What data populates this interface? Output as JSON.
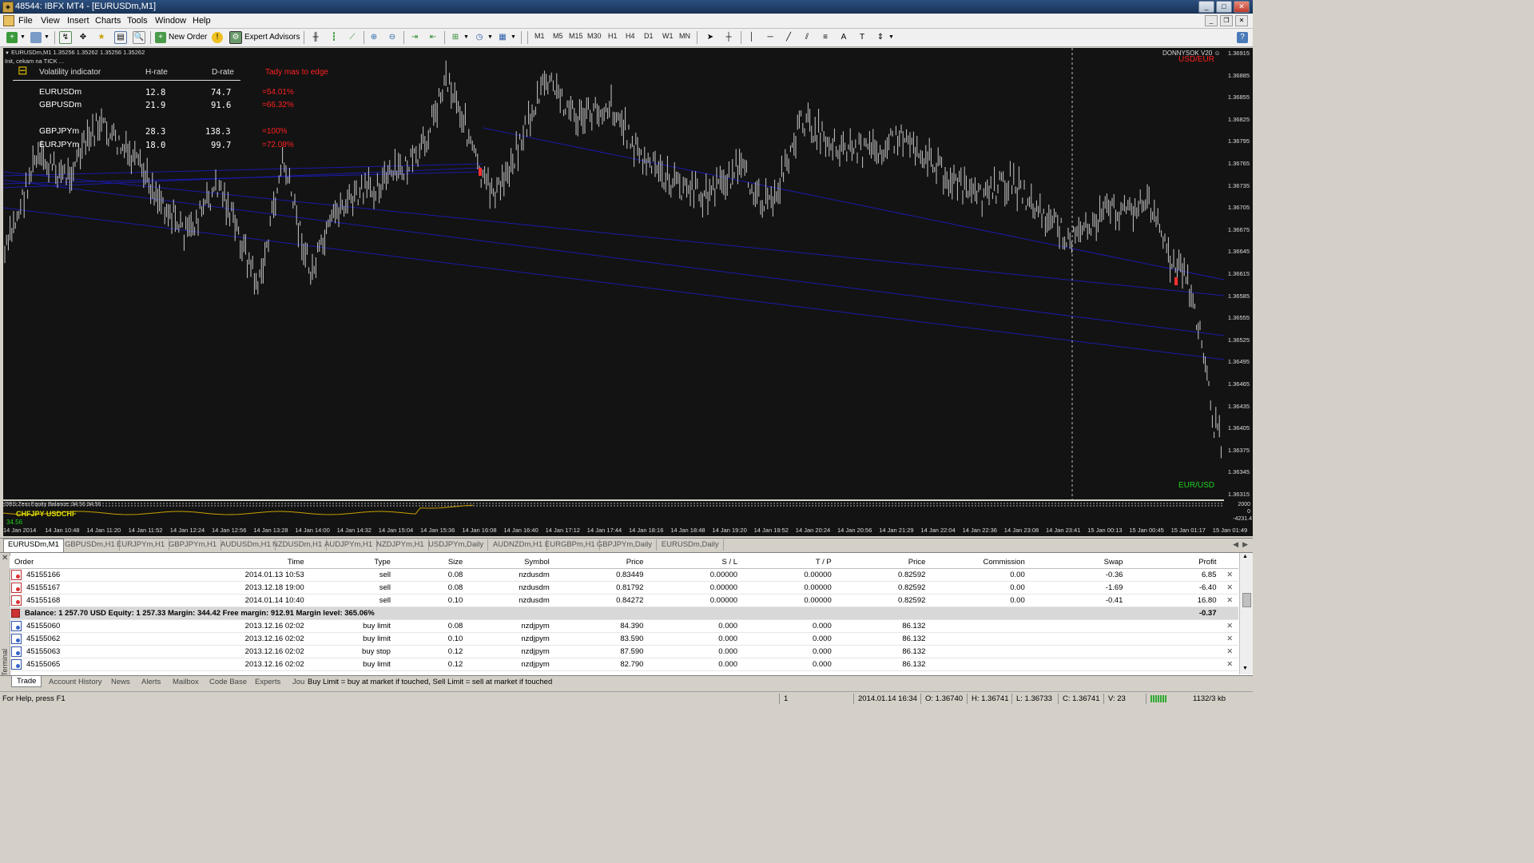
{
  "window": {
    "title": "48544: IBFX MT4 - [EURUSDm,M1]"
  },
  "menu": [
    "File",
    "View",
    "Insert",
    "Charts",
    "Tools",
    "Window",
    "Help"
  ],
  "toolbar": {
    "new_order": "New Order",
    "expert_advisors": "Expert Advisors",
    "timeframes": [
      "M1",
      "M5",
      "M15",
      "M30",
      "H1",
      "H4",
      "D1",
      "W1",
      "MN"
    ]
  },
  "chart": {
    "header": "EURUSDm,M1  1.35256 1.35262 1.35256 1.35262",
    "init_text": "Init, cekam na TICK ...",
    "donnysok": "DONNYSOK V20",
    "usd_eur": "USD/EUR",
    "eur_usd": "EUR/USD",
    "colors": {
      "bg": "#131313",
      "candle": "#c8c8c8",
      "trendline": "#1a1aa8",
      "red_label": "#ff2020",
      "green_label": "#20d020"
    },
    "indicator_table": {
      "title": "Volatility indicator",
      "col_h": "H-rate",
      "col_d": "D-rate",
      "edge_label": "Tady mas to edge",
      "rows": [
        {
          "sym": "EURUSDm",
          "h": "12.8",
          "d": "74.7",
          "edge": "=54.01%"
        },
        {
          "sym": "GBPUSDm",
          "h": "21.9",
          "d": "91.6",
          "edge": "=66.32%"
        },
        {
          "sym": "GBPJPYm",
          "h": "28.3",
          "d": "138.3",
          "edge": "=100%"
        },
        {
          "sym": "EURJPYm",
          "h": "18.0",
          "d": "99.7",
          "edge": "=72.08%"
        }
      ]
    },
    "subwindow": {
      "label": "DBS Zero Equity Balance: 34.56 34.56",
      "pair_label": "CHFJPY  USDCHF",
      "value_label": "34.56",
      "scale": [
        "2000",
        "0",
        "-4231.4"
      ]
    },
    "price_labels": [
      "1.36915",
      "1.36885",
      "1.36855",
      "1.36825",
      "1.36795",
      "1.36765",
      "1.36735",
      "1.36705",
      "1.36675",
      "1.36645",
      "1.36615",
      "1.36585",
      "1.36555",
      "1.36525",
      "1.36495",
      "1.36465",
      "1.36435",
      "1.36405",
      "1.36375",
      "1.36345",
      "1.36315"
    ],
    "time_labels": [
      "14 Jan 2014",
      "14 Jan 10:48",
      "14 Jan 11:20",
      "14 Jan 11:52",
      "14 Jan 12:24",
      "14 Jan 12:56",
      "14 Jan 13:28",
      "14 Jan 14:00",
      "14 Jan 14:32",
      "14 Jan 15:04",
      "14 Jan 15:36",
      "14 Jan 16:08",
      "14 Jan 16:40",
      "14 Jan 17:12",
      "14 Jan 17:44",
      "14 Jan 18:16",
      "14 Jan 18:48",
      "14 Jan 19:20",
      "14 Jan 19:52",
      "14 Jan 20:24",
      "14 Jan 20:56",
      "14 Jan 21:29",
      "14 Jan 22:04",
      "14 Jan 22:36",
      "14 Jan 23:08",
      "14 Jan 23:41",
      "15 Jan 00:13",
      "15 Jan 00:45",
      "15 Jan 01:17",
      "15 Jan 01:49"
    ]
  },
  "chart_tabs": [
    "EURUSDm,M1",
    "GBPUSDm,H1",
    "EURJPYm,H1",
    "GBPJPYm,H1",
    "AUDUSDm,H1",
    "NZDUSDm,H1",
    "AUDJPYm,H1",
    "NZDJPYm,H1",
    "USDJPYm,Daily",
    "AUDNZDm,H1",
    "EURGBPm,H1",
    "GBPJPYm,Daily",
    "EURUSDm,Daily"
  ],
  "trade": {
    "headers": [
      "Order",
      "Time",
      "Type",
      "Size",
      "Symbol",
      "Price",
      "S / L",
      "T / P",
      "Price",
      "Commission",
      "Swap",
      "Profit"
    ],
    "rows_sell": [
      [
        "45155166",
        "2014.01.13 10:53",
        "sell",
        "0.08",
        "nzdusdm",
        "0.83449",
        "0.00000",
        "0.00000",
        "0.82592",
        "0.00",
        "-0.36",
        "6.85"
      ],
      [
        "45155167",
        "2013.12.18 19:00",
        "sell",
        "0.08",
        "nzdusdm",
        "0.81792",
        "0.00000",
        "0.00000",
        "0.82592",
        "0.00",
        "-1.69",
        "-6.40"
      ],
      [
        "45155168",
        "2014.01.14 10:40",
        "sell",
        "0.10",
        "nzdusdm",
        "0.84272",
        "0.00000",
        "0.00000",
        "0.82592",
        "0.00",
        "-0.41",
        "16.80"
      ]
    ],
    "summary": "Balance: 1 257.70 USD  Equity: 1 257.33  Margin: 344.42  Free margin: 912.91  Margin level: 365.06%",
    "summary_profit": "-0.37",
    "rows_pending": [
      [
        "45155060",
        "2013.12.16 02:02",
        "buy limit",
        "0.08",
        "nzdjpym",
        "84.390",
        "0.000",
        "0.000",
        "86.132",
        "",
        ""
      ],
      [
        "45155062",
        "2013.12.16 02:02",
        "buy limit",
        "0.10",
        "nzdjpym",
        "83.590",
        "0.000",
        "0.000",
        "86.132",
        "",
        ""
      ],
      [
        "45155063",
        "2013.12.16 02:02",
        "buy stop",
        "0.12",
        "nzdjpym",
        "87.590",
        "0.000",
        "0.000",
        "86.132",
        "",
        ""
      ],
      [
        "45155065",
        "2013.12.16 02:02",
        "buy limit",
        "0.12",
        "nzdjpym",
        "82.790",
        "0.000",
        "0.000",
        "86.132",
        "",
        ""
      ]
    ],
    "sidebar_label": "Terminal"
  },
  "terminal_tabs": [
    "Trade",
    "Account History",
    "News",
    "Alerts",
    "Mailbox",
    "Code Base",
    "Experts",
    "Jou"
  ],
  "hint": "Buy Limit = buy at market if touched, Sell Limit = sell at market if touched",
  "status": {
    "help": "For Help, press F1",
    "one": "1",
    "time": "2014.01.14 16:34",
    "o": "O: 1.36740",
    "h": "H: 1.36741",
    "l": "L: 1.36733",
    "c": "C: 1.36741",
    "v": "V: 23",
    "kb": "1132/3 kb"
  }
}
